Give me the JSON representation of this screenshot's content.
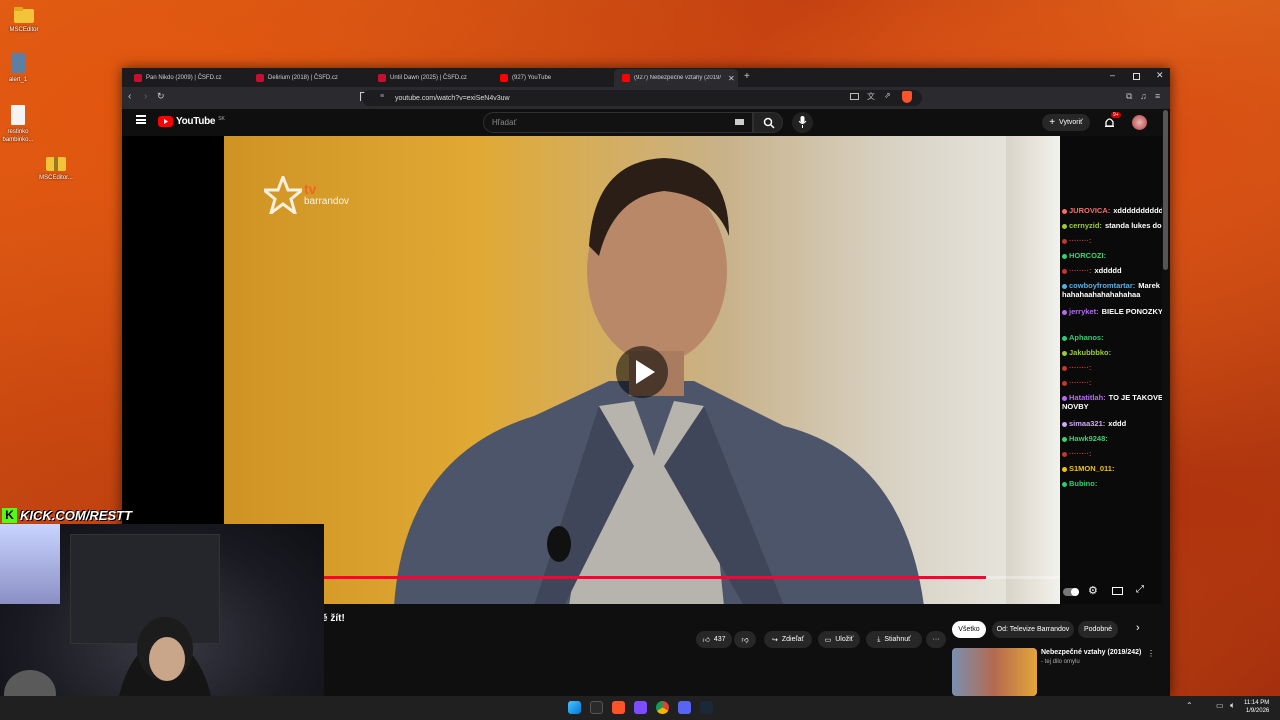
{
  "desktop": {
    "icons": [
      {
        "label": "MSCEditor"
      },
      {
        "label": "alert_1"
      },
      {
        "label": "restinko bambinko..."
      },
      {
        "label": "MSCEditor..."
      }
    ]
  },
  "browser": {
    "tabs": [
      {
        "label": "Pan Nikdo (2009) | ČSFD.cz",
        "color": "#c8102e"
      },
      {
        "label": "Delirium (2018) | ČSFD.cz",
        "color": "#c8102e"
      },
      {
        "label": "Until Dawn (2025) | ČSFD.cz",
        "color": "#c8102e"
      },
      {
        "label": "(927) YouTube",
        "color": "#ff0000"
      },
      {
        "label": "(927) Nebezpečné vztahy (2019/",
        "color": "#ff0000"
      }
    ],
    "new_tab": "+",
    "url": "youtube.com/watch?v=exiSeN4v3uw"
  },
  "youtube": {
    "logo": "YouTube",
    "country": "SK",
    "search_placeholder": "Hľadať",
    "create_label": "Vytvoriť",
    "notif_count": "9+",
    "video_title": "ě žít!",
    "like_count": "437",
    "share_label": "Zdieľať",
    "save_label": "Uložiť",
    "download_label": "Stiahnuť",
    "more_label": "···",
    "chips": [
      "Všetko",
      "Od: Televize Barrandov",
      "Podobné"
    ],
    "rec_title": "Nebezpečné vztahy (2019/242)",
    "rec_sub": "- tej dilo omylu",
    "watermark_tv": "tv",
    "watermark_name": "barrandov",
    "progress": 0.9
  },
  "chat": [
    {
      "user": "JUROVICA:",
      "msg": "xddddddddddd",
      "color": "#ff6b6b"
    },
    {
      "user": "cernyzid:",
      "msg": "standa lukes dosel",
      "color": "#9acd32"
    },
    {
      "user": "········:",
      "msg": "",
      "color": "#c0392b"
    },
    {
      "user": "HORCOZI:",
      "msg": "",
      "color": "#3bd16f"
    },
    {
      "user": "········:",
      "msg": "xddddd",
      "color": "#c0392b"
    },
    {
      "user": "cowboyfromtartar:",
      "msg": "Marek parek hahahaahahahahahaa",
      "color": "#5dade2"
    },
    {
      "user": "jerryket:",
      "msg": "BIELE PONOZKY V OBLEKU",
      "color": "#b36cf2"
    },
    {
      "user": "Aphanos:",
      "msg": "",
      "color": "#2ecc71"
    },
    {
      "user": "Jakubbbko:",
      "msg": "",
      "color": "#9acd32"
    },
    {
      "user": "········:",
      "msg": "",
      "color": "#c0392b"
    },
    {
      "user": "········:",
      "msg": "",
      "color": "#c0392b"
    },
    {
      "user": "Hatatitlah:",
      "msg": "TO JE TAKOVEJ CHYTREJSI NOVBY",
      "color": "#b36cf2"
    },
    {
      "user": "simaa321:",
      "msg": "xddd",
      "color": "#d0a9f5"
    },
    {
      "user": "Hawk9248:",
      "msg": "",
      "color": "#3bd16f"
    },
    {
      "user": "········:",
      "msg": "",
      "color": "#c0392b"
    },
    {
      "user": "S1MON_011:",
      "msg": "",
      "color": "#f1c40f"
    },
    {
      "user": "Bubino:",
      "msg": "",
      "color": "#2ecc71"
    }
  ],
  "stream": {
    "kick_url": "KICK.COM/RESTT"
  },
  "taskbar": {
    "time": "11:14 PM",
    "date": "1/9/2026"
  }
}
